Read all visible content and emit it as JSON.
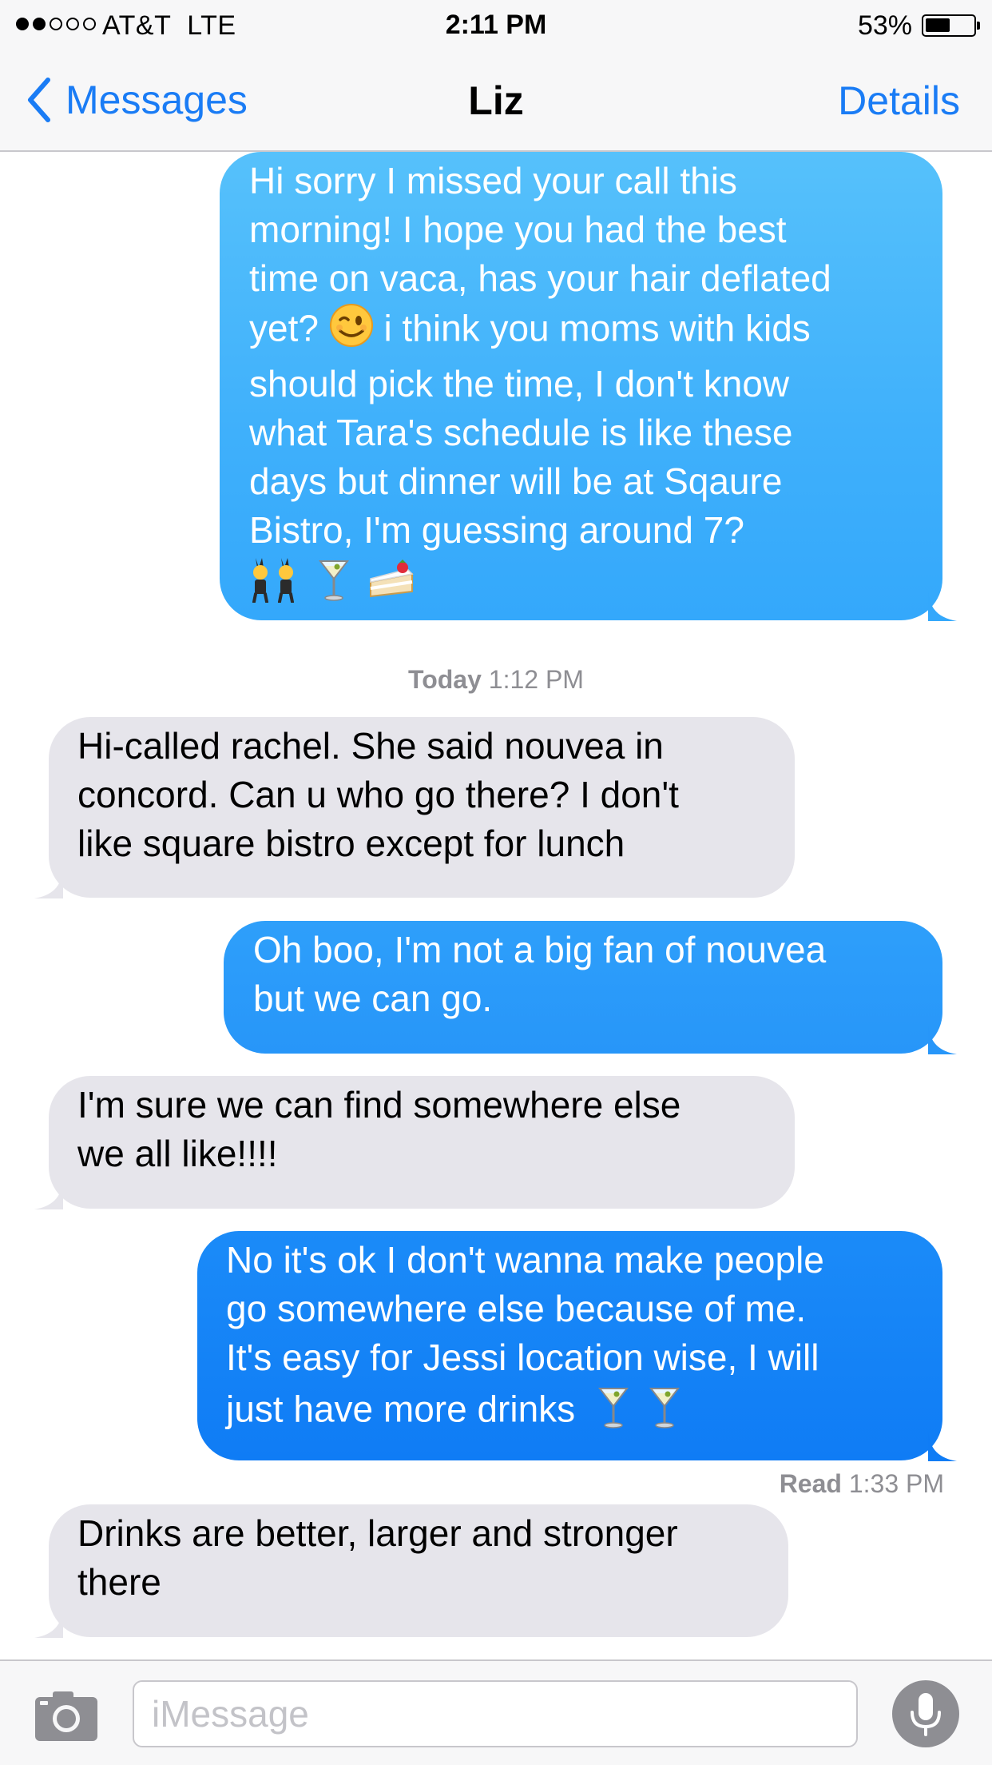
{
  "status_bar": {
    "signal_filled": 2,
    "signal_total": 5,
    "carrier": "AT&T",
    "network": "LTE",
    "time": "2:11 PM",
    "battery_percent": "53%",
    "battery_level": 0.53
  },
  "nav": {
    "back_label": "Messages",
    "title": "Liz",
    "details_label": "Details",
    "accent_color": "#1a7cf5"
  },
  "conversation": {
    "messages": [
      {
        "direction": "outgoing",
        "lines": [
          "Hi sorry I missed your call this",
          "morning! I hope you had the best",
          "time on vaca, has your hair deflated",
          "yet? [winking-face] i think you moms with kids",
          "should pick the time, I don't know",
          "what Tara's schedule is like these",
          "days but dinner will be at Sqaure",
          "Bistro, I'm guessing around 7?",
          "[dancers] [cocktail] [cake]"
        ],
        "line_1": "Hi sorry I missed your call this",
        "line_2": "morning! I hope you had the best",
        "line_3": "time on vaca, has your hair deflated",
        "line_4_before_emoji": "yet?",
        "line_4_after_emoji": "i think you moms with kids",
        "line_5": "should pick the time, I don't know",
        "line_6": "what Tara's schedule is like these",
        "line_7": "days but dinner will be at Sqaure",
        "line_8": "Bistro, I'm guessing around 7?",
        "emojis": [
          "winking-face",
          "women-with-bunny-ears",
          "cocktail-glass",
          "shortcake"
        ]
      },
      {
        "direction": "timestamp",
        "day": "Today",
        "time": "1:12 PM"
      },
      {
        "direction": "incoming",
        "line_1": "Hi-called rachel. She said nouvea in",
        "line_2": "concord. Can u who go there? I don't",
        "line_3": "like square bistro except for lunch"
      },
      {
        "direction": "outgoing",
        "line_1": "Oh boo, I'm not a big fan of nouvea",
        "line_2": "but we can go."
      },
      {
        "direction": "incoming",
        "line_1": "I'm sure we can find somewhere else",
        "line_2": "we all like!!!!"
      },
      {
        "direction": "outgoing",
        "line_1": "No it's ok I don't wanna make people",
        "line_2": "go somewhere else because of me.",
        "line_3": "It's easy for Jessi location wise, I will",
        "line_4": "just have more drinks",
        "emojis": [
          "cocktail-glass",
          "cocktail-glass"
        ]
      },
      {
        "direction": "receipt",
        "label": "Read",
        "time": "1:33 PM"
      },
      {
        "direction": "incoming",
        "line_1": "Drinks are better, larger and stronger",
        "line_2": "there"
      }
    ]
  },
  "input_bar": {
    "placeholder": "iMessage",
    "camera_icon": "camera-icon",
    "mic_icon": "microphone-icon"
  },
  "colors": {
    "outgoing_bubble_top": "#56c1fb",
    "outgoing_bubble_bottom": "#0f7cf5",
    "incoming_bubble": "#e6e5eb",
    "meta_text": "#8e8e93"
  }
}
